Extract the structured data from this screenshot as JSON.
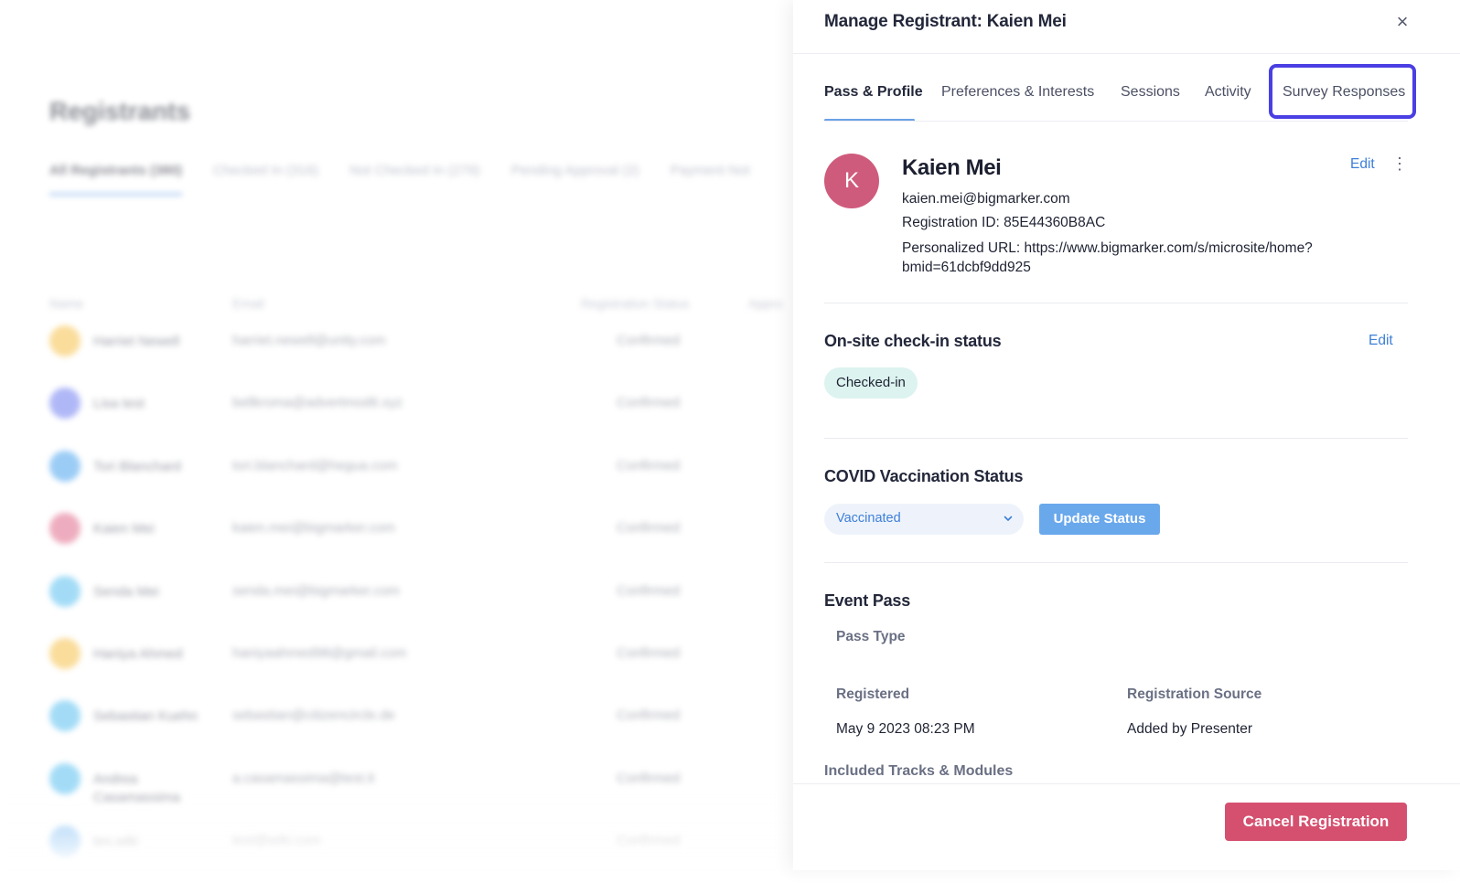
{
  "background": {
    "title": "Registrants",
    "tabs": [
      "All Registrants (380)",
      "Checked In (316)",
      "Not Checked In (279)",
      "Pending Approval (2)",
      "Payment Not"
    ],
    "columns": [
      "Name",
      "Email",
      "Registration Status",
      "Appro"
    ],
    "rows": [
      {
        "name": "Harriet Newell",
        "email": "harriet.newell@unity.com",
        "status": "Confirmed",
        "color": "#f6c14b"
      },
      {
        "name": "Lisa test",
        "email": "bellkroma@advertmod6.xyz",
        "status": "Confirmed",
        "color": "#6f7ef0"
      },
      {
        "name": "Tori Blanchard",
        "email": "tori.blanchard@hegua.com",
        "status": "Confirmed",
        "color": "#4aa3ee"
      },
      {
        "name": "Kaien Mei",
        "email": "kaien.mei@bigmarker.com",
        "status": "Confirmed",
        "color": "#e06a8b"
      },
      {
        "name": "Senda Mei",
        "email": "senda.mei@bigmarker.com",
        "status": "Confirmed",
        "color": "#58bff0"
      },
      {
        "name": "Haniya Ahmed",
        "email": "haniyaahmed98@gmail.com",
        "status": "Confirmed",
        "color": "#f6c14b"
      },
      {
        "name": "Sebastian Kuehn",
        "email": "sebastian@citizencircle.de",
        "status": "Confirmed",
        "color": "#58bff0"
      },
      {
        "name": "Andrea Casamassima",
        "email": "a.casamassima@test.it",
        "status": "Confirmed",
        "color": "#58bff0"
      },
      {
        "name": "tes.wiki",
        "email": "test@wiki.com",
        "status": "Confirmed",
        "color": "#4aa3ee"
      }
    ]
  },
  "drawer": {
    "title": "Manage Registrant: Kaien Mei",
    "close_icon": "×",
    "tabs": [
      {
        "label": "Pass & Profile",
        "active": true
      },
      {
        "label": "Preferences & Interests",
        "active": false
      },
      {
        "label": "Sessions",
        "active": false
      },
      {
        "label": "Activity",
        "active": false
      },
      {
        "label": "Survey Responses",
        "active": false,
        "highlighted": true
      }
    ],
    "profile": {
      "initial": "K",
      "avatar_color": "#cf5b7c",
      "name": "Kaien Mei",
      "email": "kaien.mei@bigmarker.com",
      "registration_id": "Registration ID: 85E44360B8AC",
      "personalized_url": "Personalized URL: https://www.bigmarker.com/s/microsite/home?bmid=61dcbf9dd925",
      "edit_label": "Edit",
      "more_icon": "⋮"
    },
    "checkin": {
      "heading": "On-site check-in status",
      "edit_label": "Edit",
      "status": "Checked-in"
    },
    "covid": {
      "heading": "COVID Vaccination Status",
      "selected": "Vaccinated",
      "update_label": "Update Status"
    },
    "event_pass": {
      "heading": "Event Pass",
      "pass_type_label": "Pass Type",
      "registered_label": "Registered",
      "registered_value": "May 9 2023 08:23 PM",
      "source_label": "Registration Source",
      "source_value": "Added by Presenter",
      "tracks_label": "Included Tracks & Modules"
    },
    "cancel_label": "Cancel Registration"
  },
  "colors": {
    "accent": "#3d7fd8",
    "highlight": "#4a3fe3",
    "danger": "#d5506f"
  }
}
